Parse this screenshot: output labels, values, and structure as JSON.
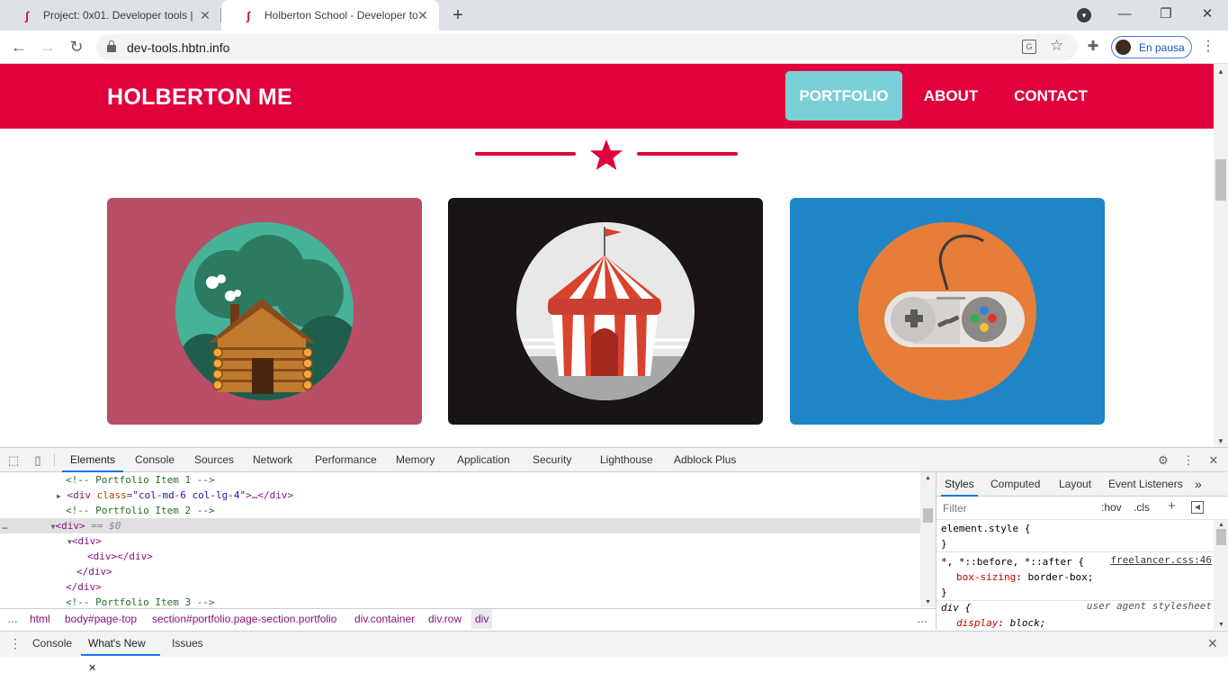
{
  "browser": {
    "tabs": [
      {
        "title": "Project: 0x01. Developer tools | H",
        "active": false
      },
      {
        "title": "Holberton School - Developer to",
        "active": true
      }
    ],
    "url": "dev-tools.hbtn.info",
    "profile_label": "En pausa",
    "icons": {
      "favicon": "holberton-seahorse-icon",
      "close": "close-icon",
      "new_tab": "plus-icon",
      "back": "arrow-left-icon",
      "forward": "arrow-right-icon",
      "reload": "reload-icon",
      "lock": "lock-icon",
      "translate": "translate-icon",
      "bookmark": "star-outline-icon",
      "extensions": "puzzle-icon",
      "menu": "kebab-menu-icon"
    }
  },
  "site": {
    "brand": "HOLBERTON ME",
    "nav": [
      {
        "label": "PORTFOLIO",
        "active": true
      },
      {
        "label": "ABOUT",
        "active": false
      },
      {
        "label": "CONTACT",
        "active": false
      }
    ],
    "divider_icon": "star-icon",
    "portfolio": [
      {
        "name": "cabin",
        "bg": "#b84e66",
        "circle": "#46b398"
      },
      {
        "name": "circus-tent",
        "bg": "#1a1414",
        "circle": "#e8e8e8"
      },
      {
        "name": "game-controller",
        "bg": "#1e85c6",
        "circle": "#e67d39"
      }
    ],
    "colors": {
      "nav": "#e0003c",
      "active_link": "#7bcfd7",
      "text": "#ffffff"
    }
  },
  "devtools": {
    "tabs": [
      "Elements",
      "Console",
      "Sources",
      "Network",
      "Performance",
      "Memory",
      "Application",
      "Security",
      "Lighthouse",
      "Adblock Plus"
    ],
    "active_tab": "Elements",
    "dom": {
      "comment1": "<!-- Portfolio Item 1 -->",
      "div1_open": "<div",
      "div1_attr": "class",
      "div1_val": "\"col-md-6 col-lg-4\"",
      "div1_rest": ">…</div>",
      "comment2": "<!-- Portfolio Item 2 -->",
      "sel_tag": "<div>",
      "sel_marker": "== $0",
      "inner_div": "<div>",
      "inner_empty": "<div></div>",
      "inner_close": "</div>",
      "outer_close": "</div>",
      "comment3": "<!-- Portfolio Item 3 -->",
      "ellipsis": "…"
    },
    "breadcrumbs": [
      "html",
      "body#page-top",
      "section#portfolio.page-section.portfolio",
      "div.container",
      "div.row",
      "div"
    ],
    "styles": {
      "tabs": [
        "Styles",
        "Computed",
        "Layout",
        "Event Listeners"
      ],
      "active_tab": "Styles",
      "filter_placeholder": "Filter",
      "hov": ":hov",
      "cls": ".cls",
      "rules": [
        {
          "selector": "element.style {",
          "close": "}"
        },
        {
          "selector": "*, *::before, *::after {",
          "source": "freelancer.css:46",
          "prop": "box-sizing",
          "value": "border-box;",
          "close": "}"
        },
        {
          "selector": "div {",
          "source": "user agent stylesheet",
          "prop": "display",
          "value": "block;"
        }
      ]
    },
    "drawer": {
      "tabs": [
        "Console",
        "What's New",
        "Issues"
      ],
      "active_tab": "What's New"
    }
  }
}
